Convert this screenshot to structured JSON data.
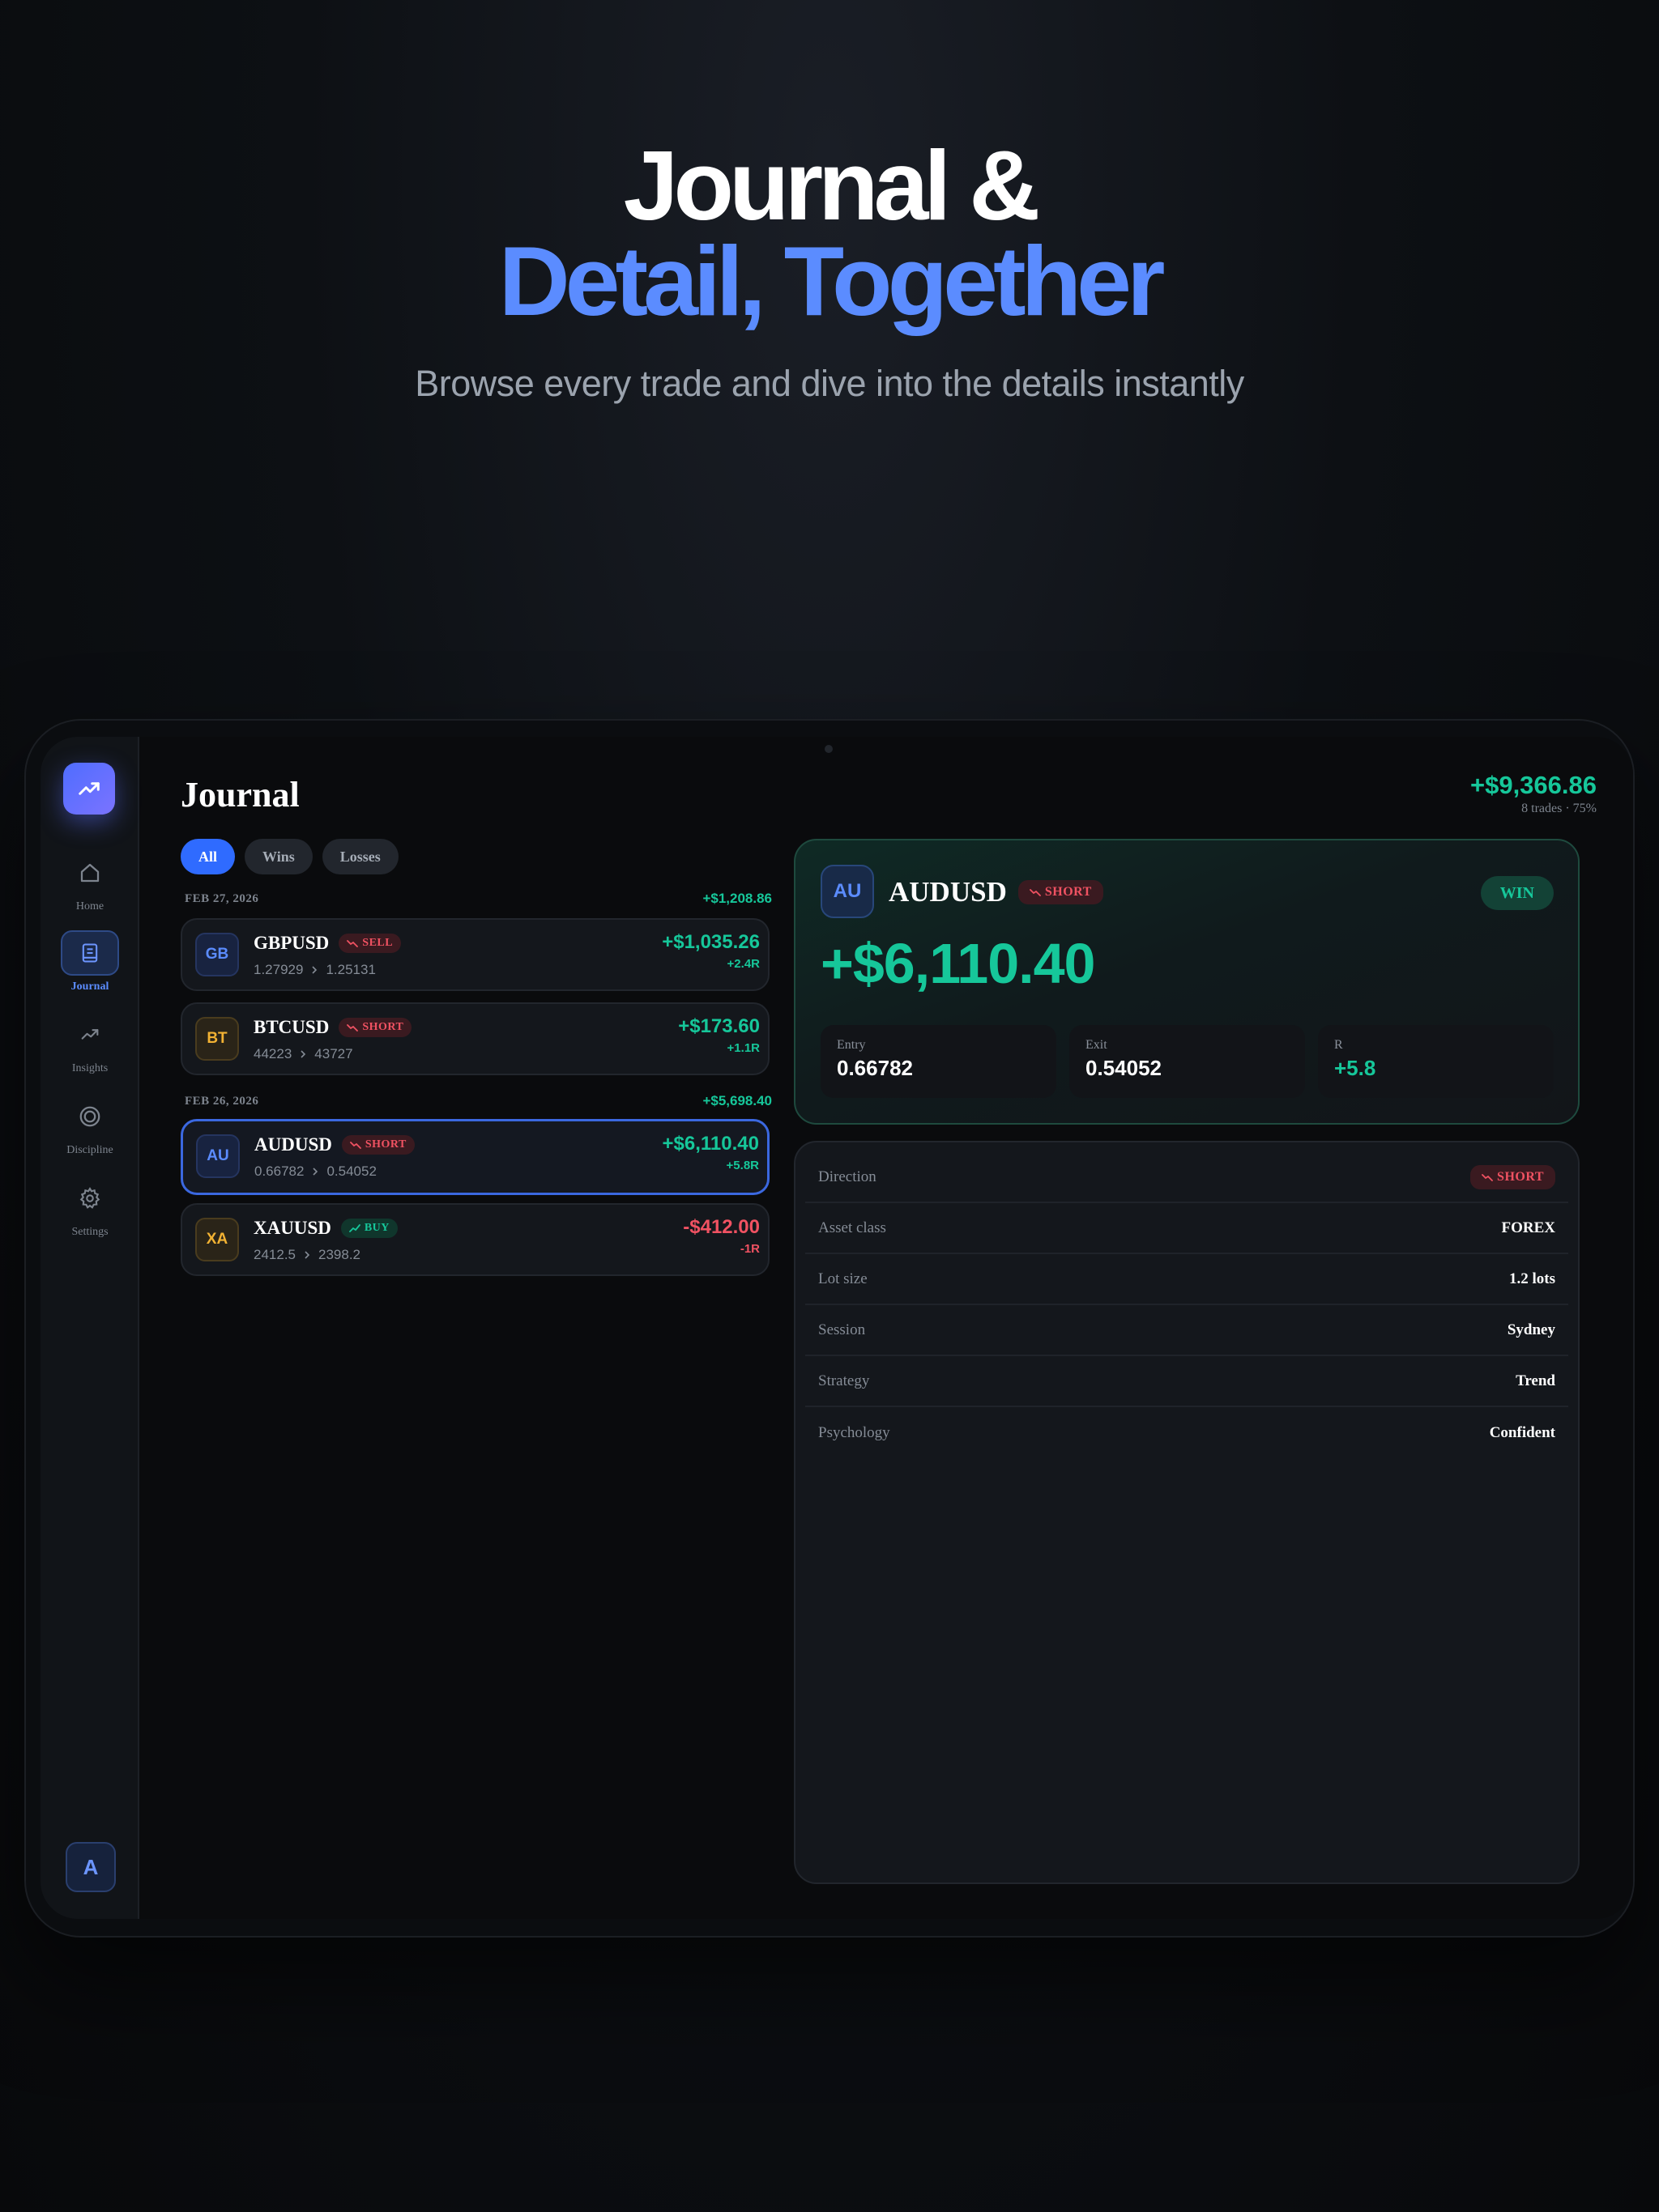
{
  "hero": {
    "line1": "Journal &",
    "line2": "Detail, Together",
    "subtitle": "Browse every trade and dive into the details instantly"
  },
  "colors": {
    "accent": "#5b8cff",
    "profit": "#16c79a",
    "loss": "#f05262",
    "background": "#0a0b0d"
  },
  "sidebar": {
    "logo_icon": "trending-up-icon",
    "items": [
      {
        "label": "Home",
        "icon": "home-icon",
        "active": false
      },
      {
        "label": "Journal",
        "icon": "journal-icon",
        "active": true
      },
      {
        "label": "Insights",
        "icon": "insights-icon",
        "active": false
      },
      {
        "label": "Discipline",
        "icon": "target-icon",
        "active": false
      },
      {
        "label": "Settings",
        "icon": "gear-icon",
        "active": false
      }
    ],
    "avatar": "A"
  },
  "header": {
    "title": "Journal",
    "total_pnl": "+$9,366.86",
    "total_meta": "8 trades · 75%"
  },
  "filters": [
    {
      "label": "All",
      "active": true
    },
    {
      "label": "Wins",
      "active": false
    },
    {
      "label": "Losses",
      "active": false
    }
  ],
  "groups": [
    {
      "date": "FEB 27, 2026",
      "total": "+$1,208.86",
      "trades": [
        {
          "badge": "GB",
          "symbol": "GBPUSD",
          "tag": "SELL",
          "entry": "1.27929",
          "exit": "1.25131",
          "pnl": "+$1,035.26",
          "r": "+2.4R"
        },
        {
          "badge": "BT",
          "symbol": "BTCUSD",
          "tag": "SHORT",
          "entry": "44223",
          "exit": "43727",
          "pnl": "+$173.60",
          "r": "+1.1R"
        }
      ]
    },
    {
      "date": "FEB 26, 2026",
      "total": "+$5,698.40",
      "trades": [
        {
          "badge": "AU",
          "symbol": "AUDUSD",
          "tag": "SHORT",
          "entry": "0.66782",
          "exit": "0.54052",
          "pnl": "+$6,110.40",
          "r": "+5.8R"
        },
        {
          "badge": "XA",
          "symbol": "XAUUSD",
          "tag": "BUY",
          "entry": "2412.5",
          "exit": "2398.2",
          "pnl": "-$412.00",
          "r": "-1R"
        }
      ]
    }
  ],
  "detail": {
    "badge": "AU",
    "symbol": "AUDUSD",
    "tag": "SHORT",
    "result": "WIN",
    "pnl": "+$6,110.40",
    "stats": [
      {
        "label": "Entry",
        "value": "0.66782"
      },
      {
        "label": "Exit",
        "value": "0.54052"
      },
      {
        "label": "R",
        "value": "+5.8"
      }
    ],
    "rows": [
      {
        "key": "Direction",
        "value": "SHORT"
      },
      {
        "key": "Asset class",
        "value": "FOREX"
      },
      {
        "key": "Lot size",
        "value": "1.2 lots"
      },
      {
        "key": "Session",
        "value": "Sydney"
      },
      {
        "key": "Strategy",
        "value": "Trend"
      },
      {
        "key": "Psychology",
        "value": "Confident"
      }
    ]
  }
}
